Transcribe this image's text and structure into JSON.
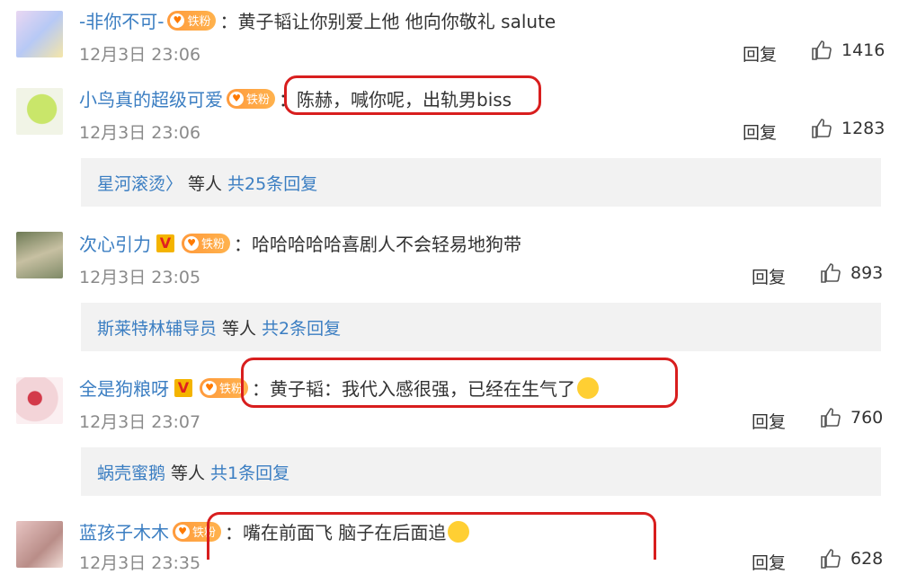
{
  "comments": [
    {
      "username": "-非你不可-",
      "text": "：黄子韬让你别爱上他 他向你敬礼 salute",
      "time": "12月3日 23:06",
      "reply": "回复",
      "likes": "1416",
      "verified": false,
      "fan_badge": "铁粉"
    },
    {
      "username": "小鸟真的超级可爱",
      "text": "：陈赫，喊你呢，出轨男biss",
      "time": "12月3日 23:06",
      "reply": "回复",
      "likes": "1283",
      "verified": false,
      "fan_badge": "铁粉",
      "sub_replies": {
        "who": "星河滚烫〉",
        "mid": "等人",
        "count": "共25条回复"
      }
    },
    {
      "username": "次心引力",
      "text": "：哈哈哈哈哈喜剧人不会轻易地狗带",
      "time": "12月3日 23:05",
      "reply": "回复",
      "likes": "893",
      "verified": true,
      "fan_badge": "铁粉",
      "sub_replies": {
        "who": "斯莱特林辅导员",
        "mid": "等人",
        "count": "共2条回复"
      }
    },
    {
      "username": "全是狗粮呀",
      "text": "：黄子韬：我代入感很强，已经在生气了",
      "time": "12月3日 23:07",
      "reply": "回复",
      "likes": "760",
      "verified": true,
      "fan_badge": "铁粉",
      "sub_replies": {
        "who": "蜗壳蜜鹅",
        "mid": "等人",
        "count": "共1条回复"
      }
    },
    {
      "username": "蓝孩子木木",
      "text": "：嘴在前面飞 脑子在后面追",
      "time": "12月3日 23:35",
      "reply": "回复",
      "likes": "628",
      "verified": false,
      "fan_badge": "铁粉"
    }
  ],
  "colors": {
    "link": "#3b7ec2",
    "highlight": "#d81e1e",
    "subbar_bg": "#f2f2f2"
  },
  "icons": [
    "thumbs-up-icon",
    "verified-v-icon",
    "fan-badge-icon",
    "emoji-icon"
  ]
}
